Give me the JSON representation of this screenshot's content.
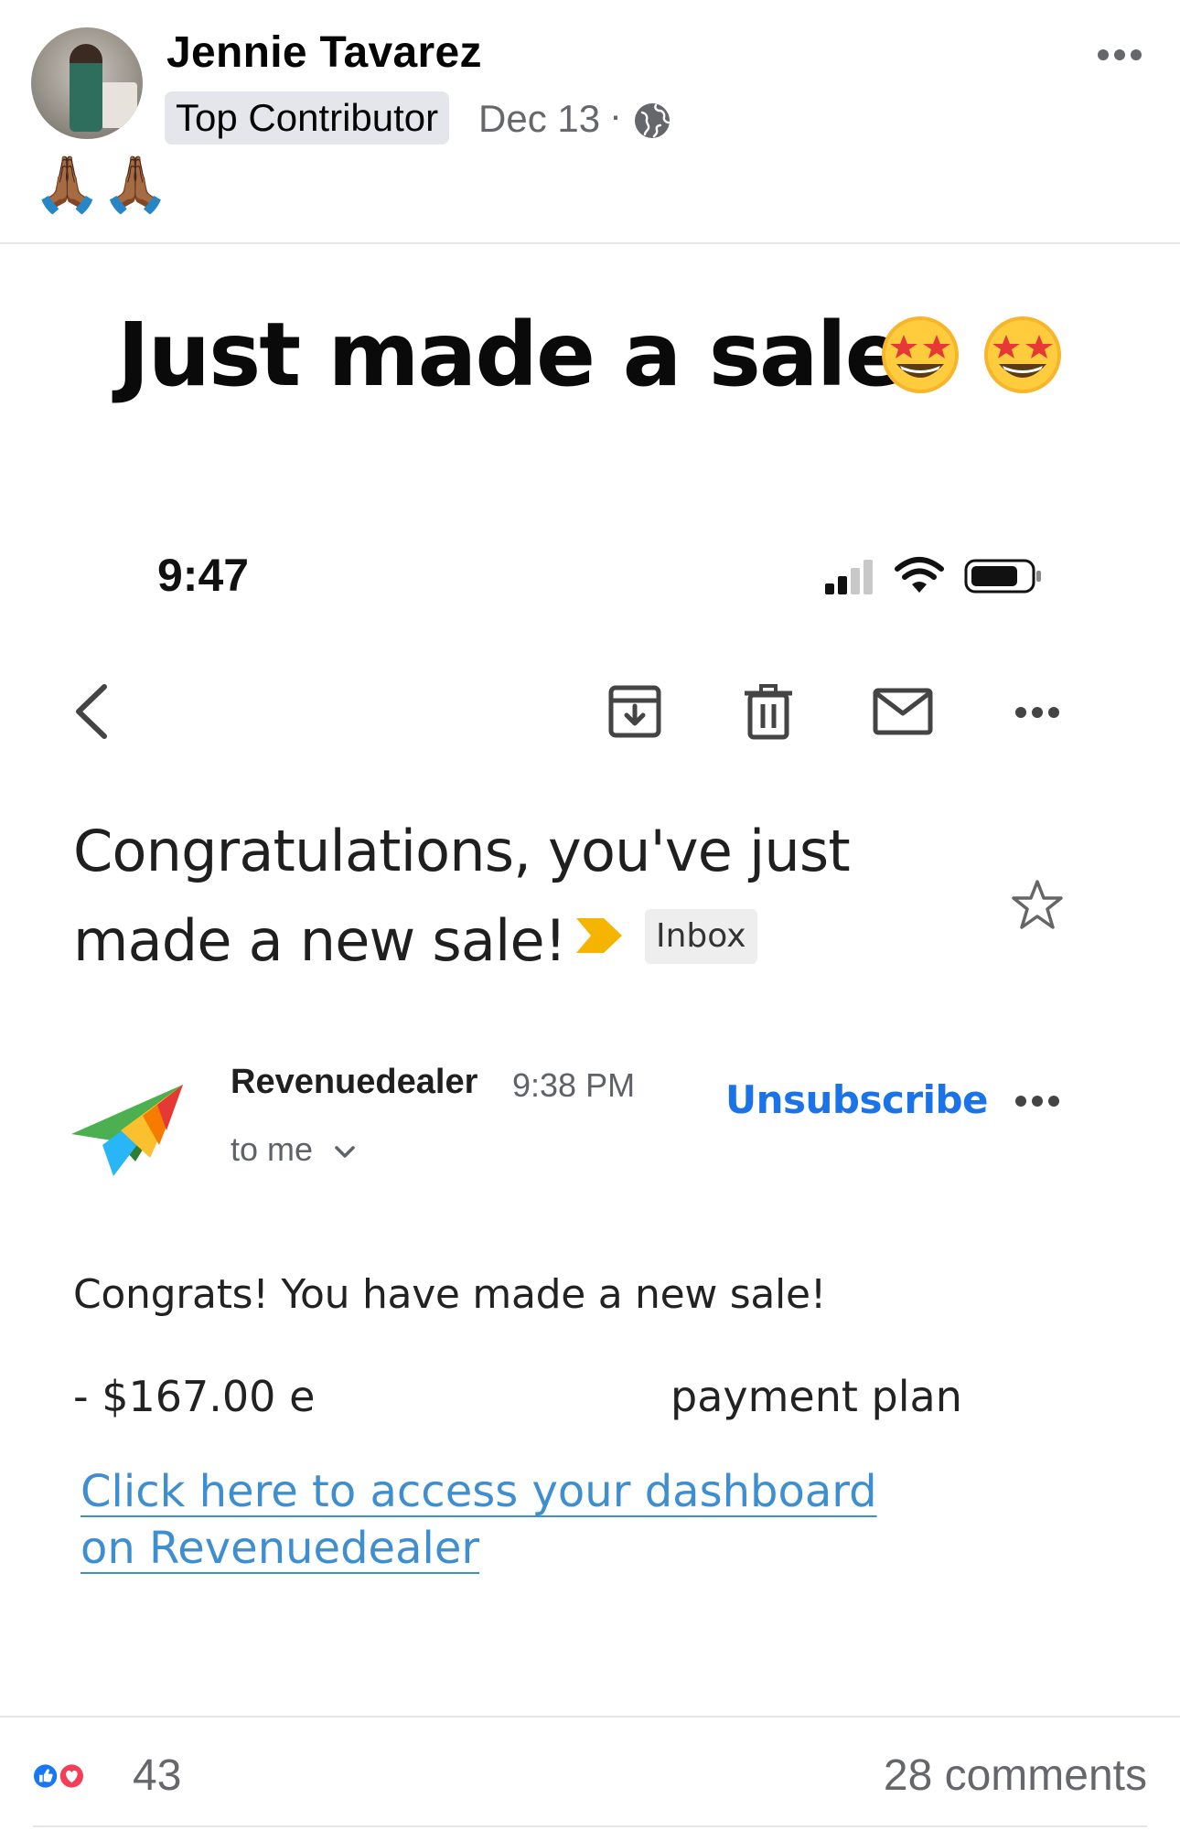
{
  "post": {
    "author_name": "Jennie Tavarez",
    "badge": "Top Contributor",
    "date": "Dec 13",
    "separator": "·",
    "emojis": "🙏🏾🙏🏾"
  },
  "image": {
    "heading": "Just made a sale",
    "status_bar": {
      "time": "9:47"
    },
    "email": {
      "subject": "Congratulations, you've just made a new sale!",
      "label": "Inbox",
      "sender_name": "Revenuedealer",
      "sender_time": "9:38 PM",
      "unsubscribe": "Unsubscribe",
      "recipient": "to me",
      "body_line": "Congrats! You have made a new sale!",
      "amount_prefix": "- $167.00 ",
      "amount_partial": "e",
      "amount_suffix": "payment plan",
      "dashboard_link_line1": "Click here to access your dashboard",
      "dashboard_link_line2": "on Revenuedealer"
    }
  },
  "footer": {
    "reaction_count": "43",
    "comments": "28 comments"
  },
  "colors": {
    "link_blue": "#1a73e8",
    "dashboard_link": "#3e8ed0",
    "secondary_text": "#65676b",
    "like_blue": "#1877f2",
    "love_red": "#f33e58",
    "important_yellow": "#f5b400"
  },
  "icons": [
    "globe-icon",
    "more-icon",
    "back-icon",
    "archive-icon",
    "trash-icon",
    "mail-icon",
    "star-icon",
    "chevron-down-icon",
    "like-icon",
    "love-icon"
  ]
}
